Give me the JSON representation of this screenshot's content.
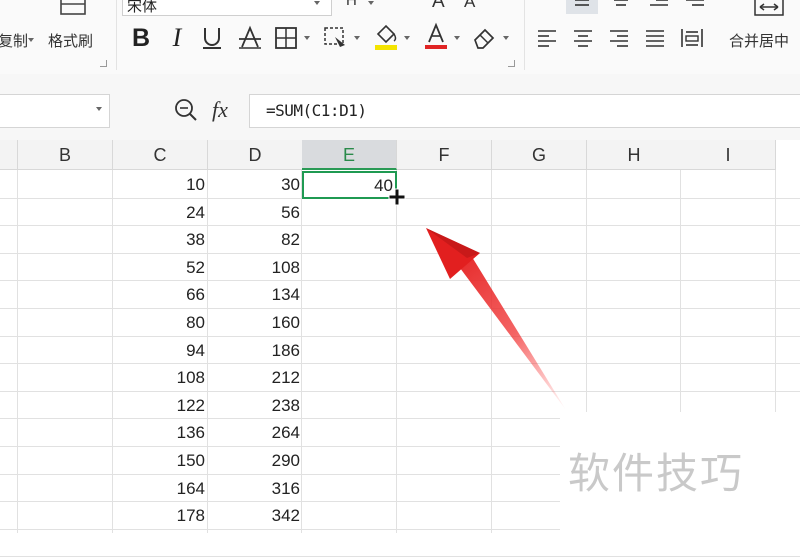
{
  "ribbon": {
    "clipboard": {
      "copy_label": "复制",
      "format_painter_label": "格式刷"
    },
    "font": {
      "font_name": "宋体"
    },
    "alignment": {
      "merge_center_label": "合并居中"
    }
  },
  "formula_bar": {
    "fx_label": "fx",
    "formula": "=SUM(C1:D1)"
  },
  "grid": {
    "columns": [
      "B",
      "C",
      "D",
      "E",
      "F",
      "G",
      "H",
      "I"
    ],
    "active_column": "E",
    "rows": [
      {
        "c": "10",
        "d": "30"
      },
      {
        "c": "24",
        "d": "56"
      },
      {
        "c": "38",
        "d": "82"
      },
      {
        "c": "52",
        "d": "108"
      },
      {
        "c": "66",
        "d": "134"
      },
      {
        "c": "80",
        "d": "160"
      },
      {
        "c": "94",
        "d": "186"
      },
      {
        "c": "108",
        "d": "212"
      },
      {
        "c": "122",
        "d": "238"
      },
      {
        "c": "136",
        "d": "264"
      },
      {
        "c": "150",
        "d": "290"
      },
      {
        "c": "164",
        "d": "316"
      },
      {
        "c": "178",
        "d": "342"
      }
    ],
    "selected_cell_value": "40"
  },
  "colors": {
    "accent": "#1f9a52",
    "arrow": "#e02424",
    "font_color_bar": "#e02424",
    "highlight_bar": "#f4e400"
  },
  "icons": [
    "bold-icon",
    "italic-icon",
    "underline-icon",
    "strikethrough-icon",
    "border-icon",
    "cell-style-icon",
    "fill-color-icon",
    "font-color-icon",
    "clear-format-icon",
    "align-left-icon",
    "align-center-icon",
    "align-right-icon",
    "justify-icon",
    "distributed-icon",
    "zoom-icon",
    "fill-handle-cursor-icon",
    "red-arrow-icon"
  ],
  "watermark": "软件技巧"
}
